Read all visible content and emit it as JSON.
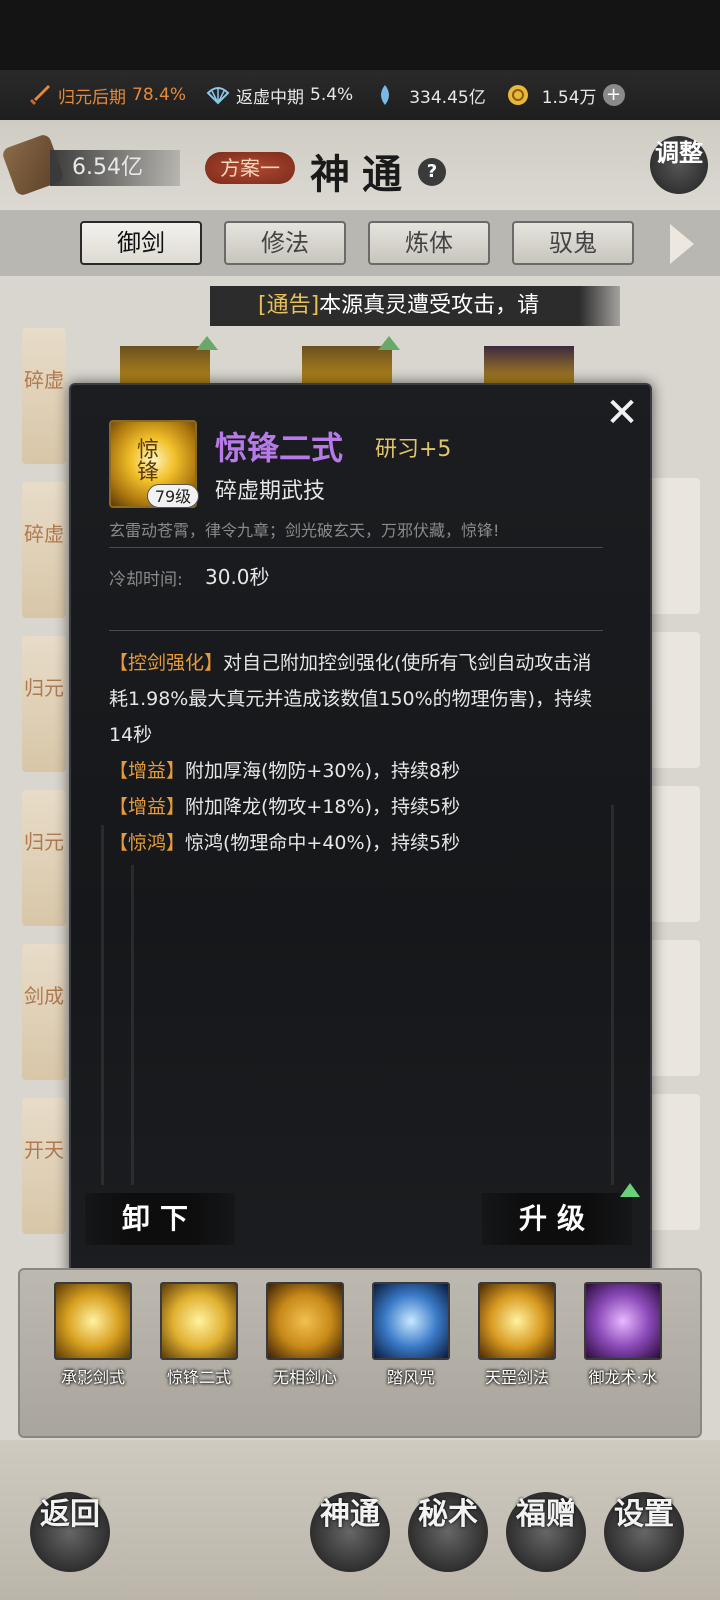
{
  "resources": {
    "realm1_label": "归元后期",
    "realm1_value": "78.4%",
    "realm2_label": "返虚中期",
    "realm2_value": "5.4%",
    "spirit_stones": "334.45亿",
    "gold": "1.54万",
    "colors": {
      "realm1": "#e68a3a",
      "text": "#e8e8e8"
    }
  },
  "header": {
    "power": "6.54亿",
    "plan": "方案一",
    "title": "神通",
    "help": "?",
    "adjust": "调整"
  },
  "tabs": [
    {
      "label": "御剑",
      "active": true
    },
    {
      "label": "修法",
      "active": false
    },
    {
      "label": "炼体",
      "active": false
    },
    {
      "label": "驭鬼",
      "active": false
    }
  ],
  "notice": {
    "tag": "[通告]",
    "text": "本源真灵遭受攻击，请"
  },
  "side_tags": [
    "碎虚",
    "碎虚",
    "归元",
    "归元",
    "剑成",
    "开天"
  ],
  "skill": {
    "name": "惊锋二式",
    "research": "研习+5",
    "level": "79级",
    "icon_glyph": "惊锋",
    "type": "碎虚期武技",
    "description": "玄雷动苍霄，律令九章；剑光破玄天，万邪伏藏，惊锋!",
    "cooldown_label": "冷却时间:",
    "cooldown_value": "30.0秒",
    "effects": [
      {
        "tag": "【控剑强化】",
        "text": "对自己附加控剑强化(使所有飞剑自动攻击消耗1.98%最大真元并造成该数值150%的物理伤害)，持续14秒"
      },
      {
        "tag": "【增益】",
        "text": "附加厚海(物防+30%)，持续8秒"
      },
      {
        "tag": "【增益】",
        "text": "附加降龙(物攻+18%)，持续5秒"
      },
      {
        "tag": "【惊鸿】",
        "text": "惊鸿(物理命中+40%)，持续5秒"
      }
    ],
    "unequip_label": "卸下",
    "upgrade_label": "升级"
  },
  "equipped": [
    {
      "name": "承影剑式",
      "icon": "golden-sword-icon",
      "color": "#d8a020"
    },
    {
      "name": "惊锋二式",
      "icon": "golden-blade-icon",
      "color": "#e0b030"
    },
    {
      "name": "无相剑心",
      "icon": "demon-eyes-icon",
      "color": "#c88a18"
    },
    {
      "name": "踏风咒",
      "icon": "blue-wind-icon",
      "color": "#3a7ac8"
    },
    {
      "name": "天罡剑法",
      "icon": "golden-burst-icon",
      "color": "#d89a20"
    },
    {
      "name": "御龙术·水",
      "icon": "purple-dragon-icon",
      "color": "#8a4ab8"
    }
  ],
  "bottom_nav": [
    {
      "label": "返回"
    },
    {
      "label": "神通"
    },
    {
      "label": "秘术"
    },
    {
      "label": "福赠"
    },
    {
      "label": "设置"
    }
  ]
}
